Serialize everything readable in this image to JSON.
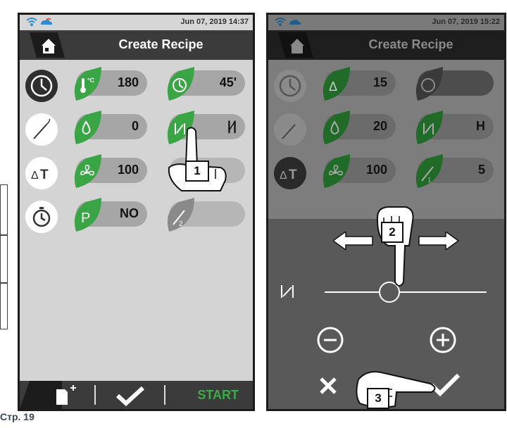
{
  "colors": {
    "accent_green": "#3aa544",
    "dark_header": "#3b3b3b",
    "pill_gray": "#a6a6a6"
  },
  "left_screen": {
    "datetime": "Jun 07, 2019  14:37",
    "title": "Create Recipe",
    "rows": [
      {
        "mode_icon": "clock-icon",
        "cells": [
          {
            "icon": "thermometer-icon",
            "value": "180"
          },
          {
            "icon": "timer-icon",
            "value": "45'"
          }
        ]
      },
      {
        "mode_icon": "probe-icon",
        "cells": [
          {
            "icon": "humidity-icon",
            "value": "0"
          },
          {
            "icon": "vent-icon",
            "value": "|∕|"
          }
        ]
      },
      {
        "mode_icon": "delta-t-icon",
        "cells": [
          {
            "icon": "fan-icon",
            "value": "100"
          },
          {
            "icon": "",
            "value": ""
          }
        ]
      },
      {
        "mode_icon": "stopwatch-icon",
        "cells": [
          {
            "icon": "p-icon",
            "value": "NO"
          },
          {
            "icon": "probe-2-icon",
            "value": ""
          }
        ]
      }
    ],
    "callout": "1",
    "bottom": {
      "new_icon": "new-document-icon",
      "confirm_icon": "check-icon",
      "start_label": "START"
    }
  },
  "right_screen": {
    "datetime": "Jun 07, 2019  15:22",
    "title": "Create Recipe",
    "rows": [
      {
        "mode_icon": "clock-icon",
        "cells": [
          {
            "icon": "delta-icon",
            "value": "15"
          },
          {
            "icon": "timer-icon",
            "value": ""
          }
        ]
      },
      {
        "mode_icon": "probe-icon",
        "cells": [
          {
            "icon": "humidity-icon",
            "value": "20"
          },
          {
            "icon": "vent-icon",
            "value": "H"
          }
        ]
      },
      {
        "mode_icon": "delta-t-icon",
        "cells": [
          {
            "icon": "fan-icon",
            "value": "100"
          },
          {
            "icon": "probe-1-icon",
            "value": "5"
          }
        ]
      }
    ],
    "callout_drag": "2",
    "callout_confirm": "3",
    "overlay": {
      "slider_label_icon": "vent-icon",
      "slider_value": 0.4,
      "minus_icon": "minus-circle-icon",
      "plus_icon": "plus-circle-icon",
      "cancel_icon": "close-icon",
      "ok_icon": "check-icon"
    }
  },
  "page_footer": "Стр. 19"
}
